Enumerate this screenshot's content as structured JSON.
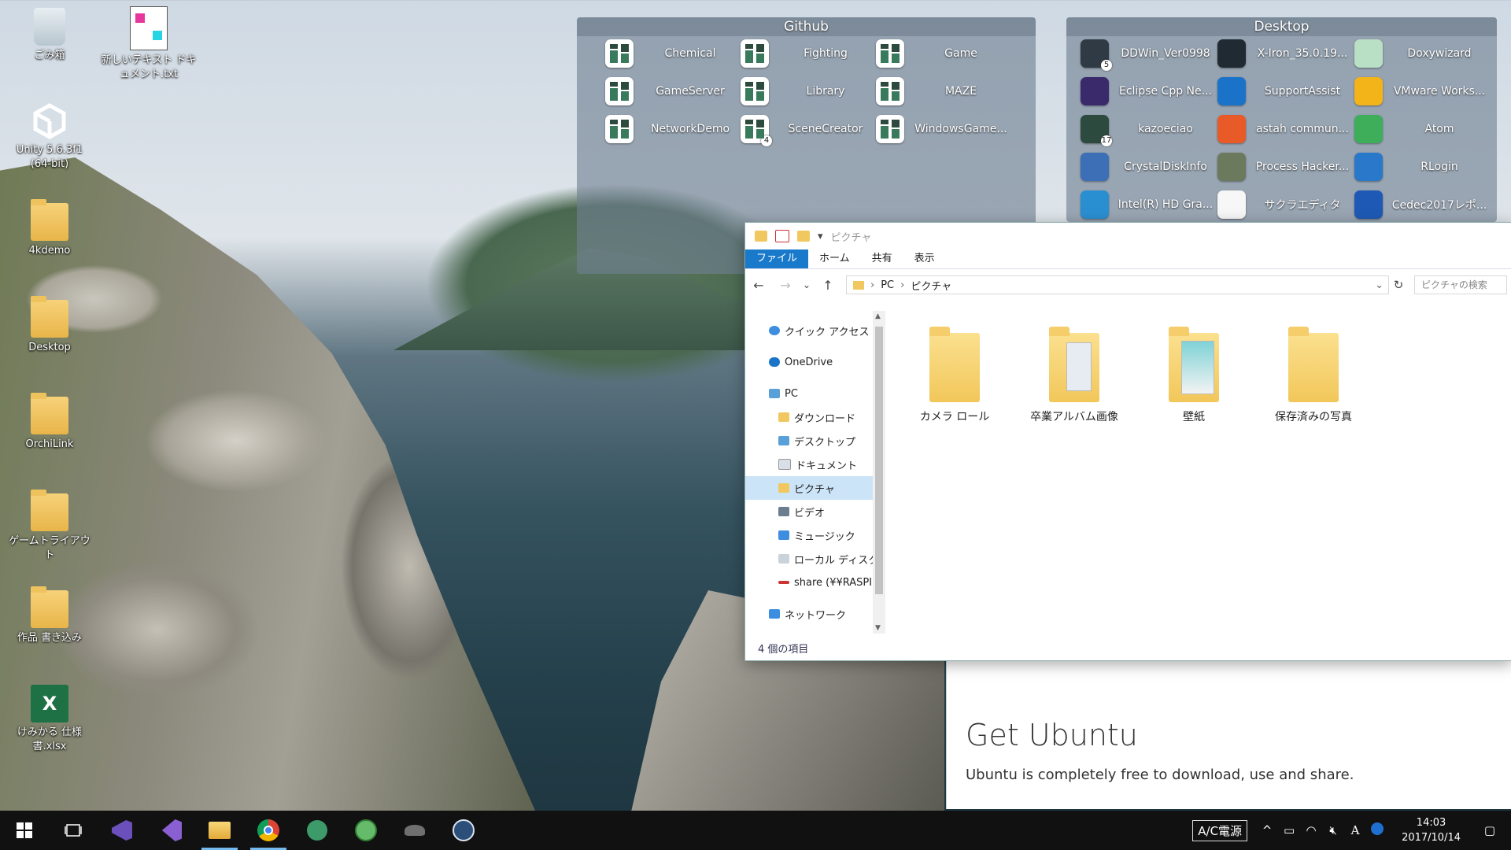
{
  "desktop_icons": [
    {
      "label": "ごみ箱"
    },
    {
      "label": "新しいテキスト ドキュメント.txt"
    },
    {
      "label": "Unity 5.6.3f1 (64-bit)"
    },
    {
      "label": "4kdemo"
    },
    {
      "label": "Desktop"
    },
    {
      "label": "OrchiLink"
    },
    {
      "label": "ゲームトライアウト"
    },
    {
      "label": "作品 書き込み"
    },
    {
      "label": "けみかる 仕様書.xlsx"
    }
  ],
  "fence_github": {
    "title": "Github",
    "items": [
      {
        "label": "Chemical"
      },
      {
        "label": "Fighting"
      },
      {
        "label": "Game"
      },
      {
        "label": "GameServer"
      },
      {
        "label": "Library"
      },
      {
        "label": "MAZE"
      },
      {
        "label": "NetworkDemo"
      },
      {
        "label": "SceneCreator",
        "badge": "4"
      },
      {
        "label": "WindowsGame..."
      }
    ]
  },
  "fence_desktop": {
    "title": "Desktop",
    "items": [
      {
        "label": "DDWin_Ver0998",
        "badge": "5"
      },
      {
        "label": "X-Iron_35.0.19..."
      },
      {
        "label": "Doxywizard"
      },
      {
        "label": "Eclipse Cpp Ne..."
      },
      {
        "label": "SupportAssist"
      },
      {
        "label": "VMware Works..."
      },
      {
        "label": "kazoeciao",
        "badge": "17"
      },
      {
        "label": "astah commun..."
      },
      {
        "label": "Atom"
      },
      {
        "label": "CrystalDiskInfo"
      },
      {
        "label": "Process Hacker..."
      },
      {
        "label": "RLogin"
      },
      {
        "label": "Intel(R) HD Gra..."
      },
      {
        "label": "サクラエディタ"
      },
      {
        "label": "Cedec2017レポ..."
      }
    ]
  },
  "explorer": {
    "title": "ピクチャ",
    "tabs": [
      "ファイル",
      "ホーム",
      "共有",
      "表示"
    ],
    "breadcrumb": [
      "PC",
      "ピクチャ"
    ],
    "search_placeholder": "ピクチャの検索",
    "nav": [
      {
        "label": "クイック アクセス"
      },
      {
        "label": "OneDrive"
      },
      {
        "label": "PC"
      },
      {
        "label": "ダウンロード"
      },
      {
        "label": "デスクトップ"
      },
      {
        "label": "ドキュメント"
      },
      {
        "label": "ピクチャ"
      },
      {
        "label": "ビデオ"
      },
      {
        "label": "ミュージック"
      },
      {
        "label": "ローカル ディスク (C:)"
      },
      {
        "label": "share (¥¥RASPI"
      },
      {
        "label": "ネットワーク"
      }
    ],
    "folders": [
      {
        "label": "カメラ ロール"
      },
      {
        "label": "卒業アルバム画像"
      },
      {
        "label": "壁紙"
      },
      {
        "label": "保存済みの写真"
      }
    ],
    "status": "4 個の項目"
  },
  "ubuntu": {
    "heading": "Get Ubuntu",
    "text": "Ubuntu is completely free to download, use and share."
  },
  "taskbar": {
    "ac": "A/C電源",
    "ime": "A",
    "time": "14:03",
    "date": "2017/10/14"
  },
  "colors": {
    "accent": "#1979ca",
    "taskbar": "#111111",
    "fence": "#708092"
  }
}
